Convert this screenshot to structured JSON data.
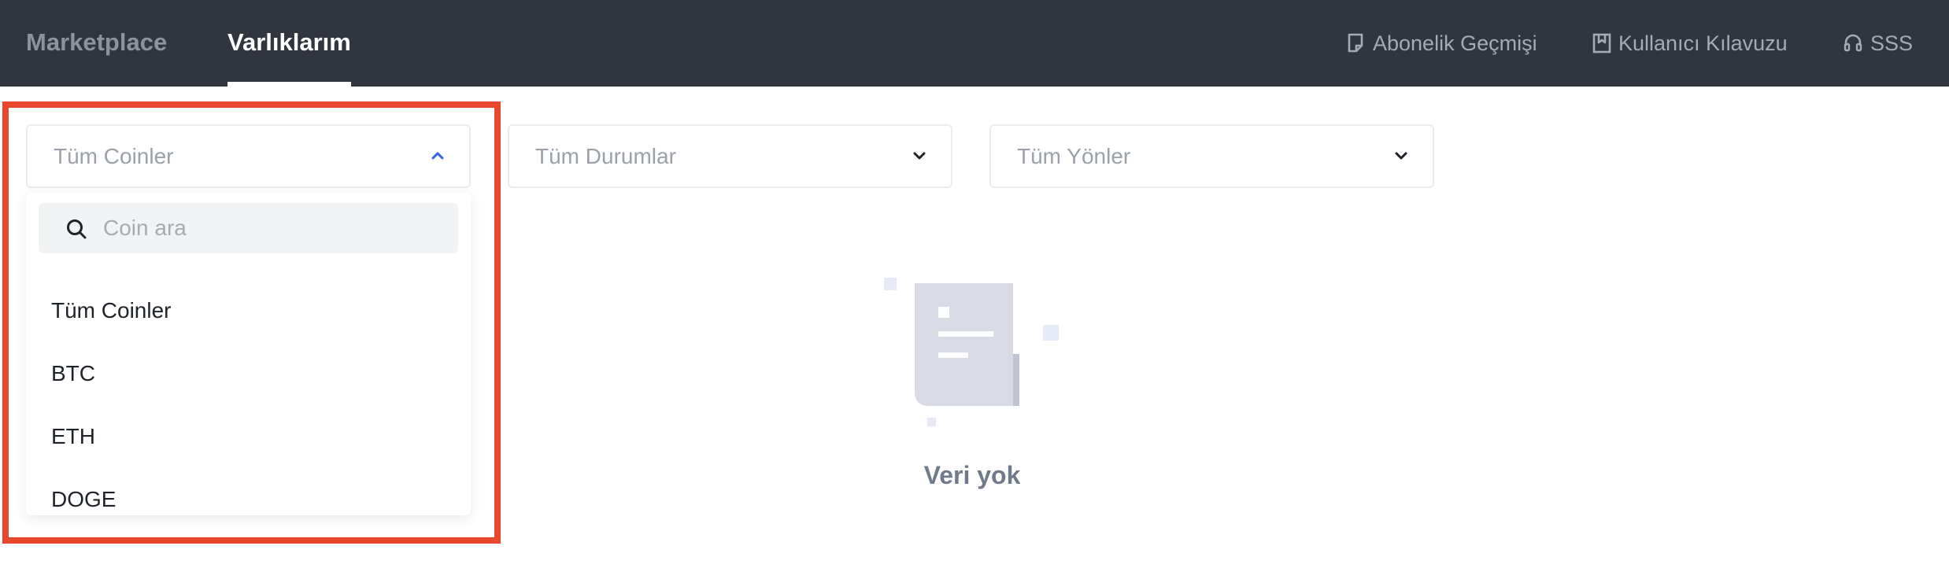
{
  "header": {
    "tabs": [
      {
        "label": "Marketplace",
        "active": false
      },
      {
        "label": "Varlıklarım",
        "active": true
      }
    ],
    "links": [
      {
        "label": "Abonelik Geçmişi",
        "icon": "document-icon"
      },
      {
        "label": "Kullanıcı Kılavuzu",
        "icon": "book-icon"
      },
      {
        "label": "SSS",
        "icon": "headset-icon"
      }
    ]
  },
  "filters": {
    "coins": {
      "placeholder": "Tüm Coinler",
      "open": true
    },
    "status": {
      "placeholder": "Tüm Durumlar",
      "open": false
    },
    "direction": {
      "placeholder": "Tüm Yönler",
      "open": false
    }
  },
  "coin_dropdown": {
    "search_placeholder": "Coin ara",
    "options": [
      "Tüm Coinler",
      "BTC",
      "ETH",
      "DOGE"
    ]
  },
  "empty_state": {
    "text": "Veri yok"
  },
  "colors": {
    "header_bg": "#30353f",
    "highlight": "#e8472c"
  }
}
